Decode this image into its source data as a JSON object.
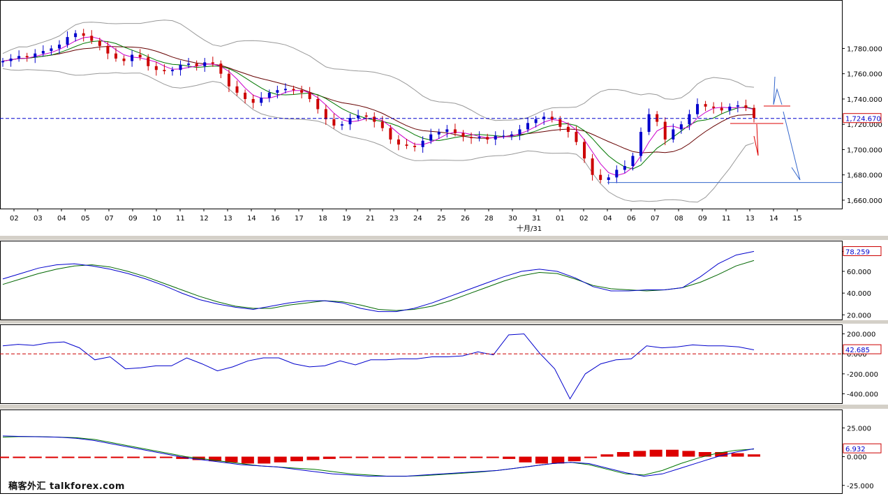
{
  "watermark": "稿客外汇 talkforex.com",
  "chart_data": [
    {
      "type": "candlestick",
      "panel": "price",
      "ylim": [
        1655,
        1815
      ],
      "y_ticks": [
        "1,780.000",
        "1,760.000",
        "1,740.000",
        "1,720.000",
        "1,700.000",
        "1,680.000",
        "1,660.000"
      ],
      "y_tick_values": [
        1780,
        1760,
        1740,
        1720,
        1700,
        1680,
        1660
      ],
      "x_tick_labels": [
        "02",
        "03",
        "04",
        "05",
        "07",
        "09",
        "10",
        "11",
        "12",
        "13",
        "14",
        "16",
        "17",
        "18",
        "19",
        "21",
        "23",
        "24",
        "25",
        "26",
        "28",
        "30",
        "31",
        "01",
        "02",
        "04",
        "06",
        "07",
        "08",
        "09",
        "11",
        "13",
        "14",
        "15"
      ],
      "month_label": "十月/31",
      "current_price_label": "1,724.670",
      "current_price": 1724.67,
      "support_level": 1674,
      "colors": {
        "up": "#0000cc",
        "down": "#cc0000",
        "ma_fast": "#cc00cc",
        "ma_mid": "#007700",
        "ma_slow": "#660000",
        "bands": "#999999",
        "current": "#0000cc"
      },
      "close": [
        1770,
        1772,
        1774,
        1773,
        1776,
        1778,
        1780,
        1783,
        1789,
        1792,
        1790,
        1786,
        1782,
        1776,
        1772,
        1770,
        1775,
        1773,
        1766,
        1763,
        1762,
        1763,
        1767,
        1768,
        1766,
        1769,
        1768,
        1760,
        1750,
        1745,
        1740,
        1737,
        1741,
        1745,
        1747,
        1748,
        1747,
        1745,
        1740,
        1732,
        1724,
        1719,
        1720,
        1725,
        1727,
        1726,
        1722,
        1717,
        1708,
        1704,
        1703,
        1702,
        1707,
        1712,
        1714,
        1716,
        1713,
        1710,
        1709,
        1710,
        1708,
        1711,
        1711,
        1712,
        1716,
        1721,
        1724,
        1726,
        1724,
        1718,
        1714,
        1706,
        1693,
        1680,
        1676,
        1678,
        1684,
        1687,
        1695,
        1714,
        1728,
        1722,
        1708,
        1716,
        1720,
        1728,
        1736,
        1734,
        1733,
        1731,
        1734,
        1735,
        1733,
        1725
      ],
      "series": [
        {
          "name": "",
          "panel": "oscillator-1",
          "ylim": [
            17,
            85
          ],
          "ticks": [
            "78.259",
            "60.000",
            "40.000",
            "20.000"
          ],
          "tick_values": [
            78.259,
            60,
            40,
            20
          ],
          "current_label": "78.259",
          "current": 78.259,
          "color": "#0000cc",
          "values": [
            53,
            58,
            63,
            66,
            67,
            65,
            62,
            58,
            53,
            47,
            40,
            34,
            30,
            27,
            25,
            28,
            31,
            33,
            33,
            31,
            26,
            23,
            23,
            26,
            31,
            37,
            43,
            49,
            55,
            60,
            62,
            60,
            54,
            46,
            42,
            42,
            43,
            43,
            45,
            55,
            67,
            75,
            78.3
          ]
        },
        {
          "name": "",
          "panel": "oscillator-1",
          "color": "#006600",
          "values": [
            48,
            53,
            58,
            62,
            65,
            66,
            64,
            60,
            55,
            49,
            43,
            37,
            32,
            28,
            26,
            26,
            29,
            31,
            33,
            32,
            29,
            25,
            24,
            25,
            28,
            33,
            39,
            45,
            51,
            56,
            59,
            58,
            53,
            47,
            44,
            43,
            42,
            43,
            45,
            50,
            57,
            65,
            70
          ]
        },
        {
          "name": "",
          "panel": "oscillator-2",
          "ylim": [
            -480,
            260
          ],
          "ticks": [
            "200.000",
            "0.000",
            "-200.000",
            "-400.000"
          ],
          "tick_values": [
            200,
            0,
            -200,
            -400
          ],
          "current_label": "42.685",
          "current": 42.685,
          "color": "#0000cc",
          "zero_color": "#cc0000",
          "values": [
            80,
            95,
            85,
            110,
            120,
            60,
            -60,
            -30,
            -150,
            -140,
            -120,
            -120,
            -40,
            -100,
            -170,
            -130,
            -70,
            -40,
            -40,
            -100,
            -130,
            -120,
            -70,
            -110,
            -60,
            -60,
            -50,
            -50,
            -30,
            -30,
            -20,
            20,
            -10,
            190,
            200,
            10,
            -150,
            -450,
            -200,
            -100,
            -60,
            -50,
            80,
            60,
            70,
            90,
            80,
            80,
            70,
            40
          ]
        },
        {
          "name": "",
          "panel": "oscillator-3",
          "ylim": [
            -30,
            38
          ],
          "ticks": [
            "25.000",
            "0.000",
            "-25.000"
          ],
          "tick_values": [
            25,
            0,
            -25
          ],
          "current_label": "6.932",
          "current": 6.932,
          "color": "#0000cc",
          "signal_color": "#007700",
          "hist_color": "#dd0000",
          "values": [
            18,
            17.6,
            17.3,
            17,
            16,
            14,
            11,
            8,
            5,
            2,
            -1,
            -3,
            -5,
            -7,
            -8,
            -9,
            -11,
            -13,
            -15,
            -16,
            -17,
            -17,
            -17,
            -16,
            -15,
            -14,
            -13,
            -12,
            -10,
            -8,
            -6,
            -5,
            -6,
            -10,
            -14,
            -17,
            -15,
            -10,
            -5,
            0,
            4,
            6.9
          ],
          "signal": [
            17,
            17.5,
            17.4,
            17,
            16.5,
            15,
            12,
            9,
            6,
            3,
            0,
            -2,
            -4,
            -6,
            -8,
            -9,
            -10,
            -11,
            -13,
            -15,
            -16,
            -17,
            -17,
            -16.5,
            -15.5,
            -14.5,
            -13.5,
            -12,
            -10,
            -8,
            -6,
            -5,
            -7,
            -11,
            -15,
            -16,
            -12,
            -6,
            -1,
            3,
            5.5,
            6.6
          ],
          "histogram": [
            0,
            0,
            0,
            0,
            0,
            0,
            0,
            0,
            0,
            0,
            -1,
            -2,
            -3,
            -4,
            -5,
            -6,
            -6,
            -5,
            -4,
            -3,
            -2,
            -1,
            0,
            0,
            0,
            0,
            0,
            0,
            0,
            0,
            0,
            -2,
            -5,
            -6,
            -6,
            -4,
            -1,
            2,
            4,
            5,
            6,
            6,
            5,
            4,
            4,
            3,
            2
          ]
        }
      ]
    }
  ]
}
